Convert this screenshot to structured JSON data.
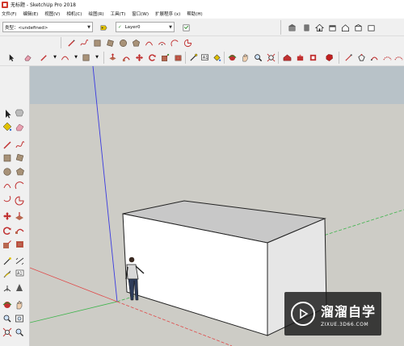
{
  "window": {
    "title": "无标题 - SketchUp Pro 2018"
  },
  "menu": {
    "items": [
      "文件(F)",
      "编辑(E)",
      "视图(V)",
      "相机(C)",
      "绘图(R)",
      "工具(T)",
      "窗口(W)",
      "扩展程序 (x)",
      "帮助(H)"
    ]
  },
  "toolbar": {
    "tag_label": "类型：<undefined>",
    "layer_check": "✓",
    "layer_name": "Layer0"
  },
  "icons": {
    "row1_mid": [
      "pencil-icon",
      "freehand-icon",
      "rect-icon",
      "rect-icon",
      "circle-icon",
      "polygon-icon",
      "arc-icon",
      "arc-icon",
      "arc-icon",
      "arc-icon"
    ],
    "row1_right": [
      "warehouse-icon",
      "trimble-icon",
      "home-icon",
      "front-icon",
      "home-icon",
      "camera-icon"
    ],
    "row2": [
      "select-icon",
      "eraser-icon",
      "pencil-icon",
      "arc-icon",
      "rect-icon",
      "pushpull-icon",
      "move-icon",
      "rotate-icon",
      "scale-icon",
      "offset-icon",
      "tape-icon",
      "text-icon",
      "paint-icon",
      "orbit-icon",
      "pan-icon",
      "zoom-icon",
      "zoom-extents-icon",
      "section-icon",
      "warehouse-icon",
      "sandbox-icon",
      "sandbox-icon",
      "sandbox-icon",
      "sandbox-icon",
      "sandbox-icon"
    ]
  },
  "watermark": {
    "name": "溜溜自学",
    "url": "ZIXUE.3D66.COM"
  },
  "colors": {
    "sky": "#b8c2c8",
    "ground": "#cdccc6",
    "box_top": "#c8c8c8",
    "box_front": "#ffffff",
    "box_side": "#e6e6e6",
    "axis_red": "#e04848",
    "axis_green": "#3cb44a",
    "axis_blue": "#3a3ae0"
  }
}
